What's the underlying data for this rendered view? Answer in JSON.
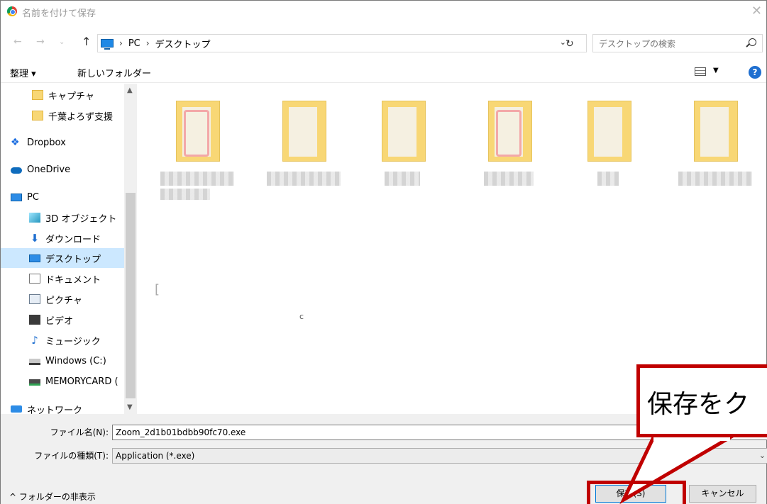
{
  "window": {
    "title": "名前を付けて保存"
  },
  "addressbar": {
    "crumbs": [
      "PC",
      "デスクトップ"
    ],
    "search_placeholder": "デスクトップの検索"
  },
  "toolbar": {
    "organize": "整理 ▾",
    "new_folder": "新しいフォルダー"
  },
  "navpane": {
    "items": [
      {
        "label": "キャプチャ",
        "icon": "folder-icon"
      },
      {
        "label": "千葉よろず支援",
        "icon": "folder-icon"
      },
      {
        "label": "Dropbox",
        "icon": "dropbox-icon"
      },
      {
        "label": "OneDrive",
        "icon": "cloud-icon"
      },
      {
        "label": "PC",
        "icon": "computer-icon"
      },
      {
        "label": "3D オブジェクト",
        "icon": "cube-icon"
      },
      {
        "label": "ダウンロード",
        "icon": "download-icon"
      },
      {
        "label": "デスクトップ",
        "icon": "desktop-icon",
        "selected": true
      },
      {
        "label": "ドキュメント",
        "icon": "document-icon"
      },
      {
        "label": "ピクチャ",
        "icon": "picture-icon"
      },
      {
        "label": "ビデオ",
        "icon": "video-icon"
      },
      {
        "label": "ミュージック",
        "icon": "music-icon"
      },
      {
        "label": "Windows (C:)",
        "icon": "drive-icon"
      },
      {
        "label": "MEMORYCARD (",
        "icon": "memory-card-icon"
      },
      {
        "label": "ネットワーク",
        "icon": "network-icon"
      }
    ]
  },
  "files": [
    {
      "variant": "red"
    },
    {
      "variant": "plain"
    },
    {
      "variant": "plain"
    },
    {
      "variant": "red"
    },
    {
      "variant": "plain"
    },
    {
      "variant": "plain"
    }
  ],
  "form": {
    "filename_label": "ファイル名(N):",
    "filename_value": "Zoom_2d1b01bdbb90fc70.exe",
    "filetype_label": "ファイルの種類(T):",
    "filetype_value": "Application (*.exe)",
    "hide_folders": "^ フォルダーの非表示",
    "save_button": "保存(S)",
    "cancel_button": "キャンセル"
  },
  "annotation": {
    "callout_text": "保存をク",
    "color": "#c00000"
  }
}
